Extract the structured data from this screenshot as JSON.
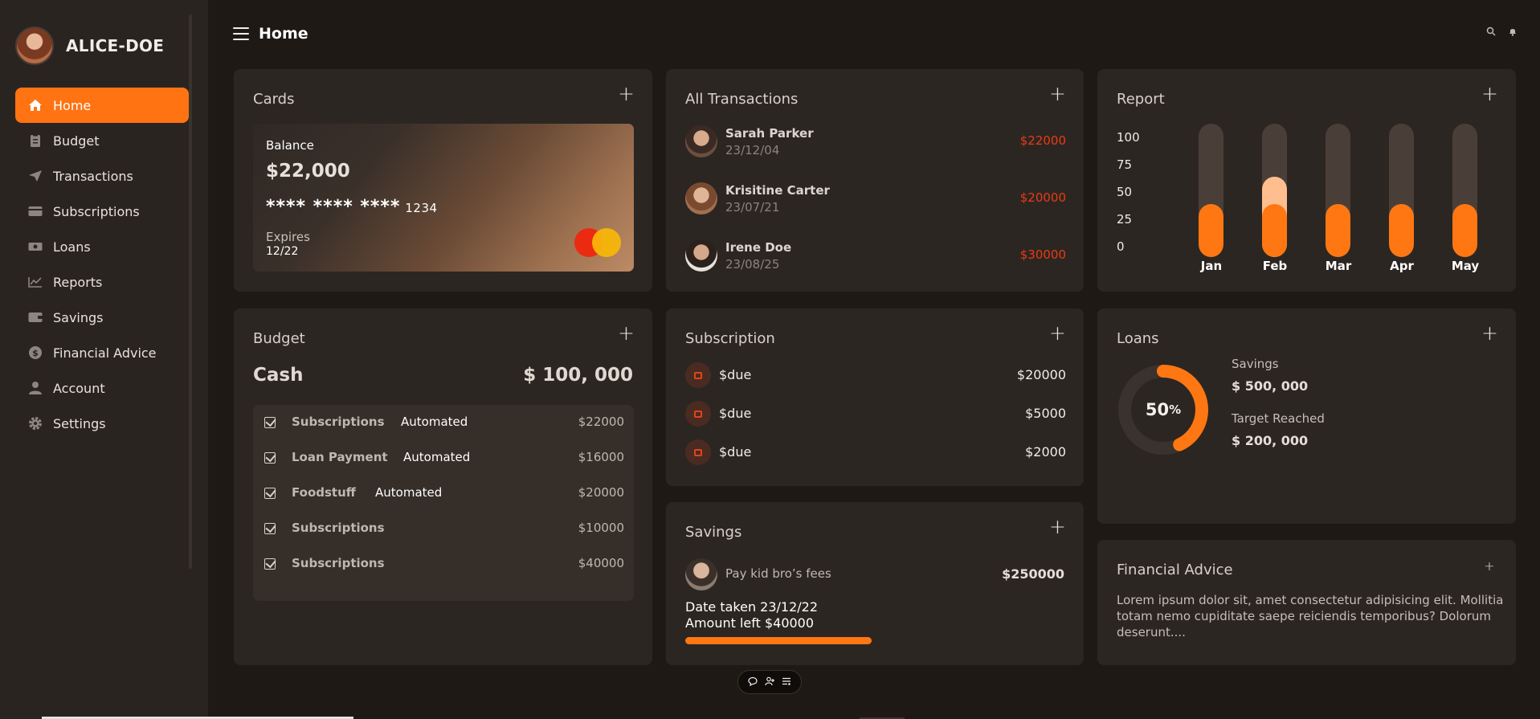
{
  "sidebar": {
    "user_name": "ALICE-DOE",
    "items": [
      {
        "label": "Home",
        "icon": "home-icon"
      },
      {
        "label": "Budget",
        "icon": "clipboard-icon"
      },
      {
        "label": "Transactions",
        "icon": "send-icon"
      },
      {
        "label": "Subscriptions",
        "icon": "wallet-icon"
      },
      {
        "label": "Loans",
        "icon": "cash-icon"
      },
      {
        "label": "Reports",
        "icon": "chart-icon"
      },
      {
        "label": "Savings",
        "icon": "wallet-icon"
      },
      {
        "label": "Financial Advice",
        "icon": "dollar-icon"
      },
      {
        "label": "Account",
        "icon": "user-icon"
      },
      {
        "label": "Settings",
        "icon": "gear-icon"
      }
    ]
  },
  "header": {
    "title": "Home"
  },
  "cards": {
    "title": "Cards",
    "balance_label": "Balance",
    "balance": "$22,000",
    "masked": "**** **** ****",
    "last4": "1234",
    "expires_label": "Expires",
    "expires": "12/22"
  },
  "transactions": {
    "title": "All Transactions",
    "rows": [
      {
        "name": "Sarah Parker",
        "date": "23/12/04",
        "amount": "$22000"
      },
      {
        "name": "Krisitine Carter",
        "date": "23/07/21",
        "amount": "$20000"
      },
      {
        "name": "Irene Doe",
        "date": "23/08/25",
        "amount": "$30000"
      }
    ]
  },
  "report": {
    "title": "Report"
  },
  "chart_data": {
    "type": "bar",
    "categories": [
      "Jan",
      "Feb",
      "Mar",
      "Apr",
      "May"
    ],
    "series": [
      {
        "values": [
          40,
          40,
          40,
          40,
          40
        ]
      },
      {
        "values": [
          0,
          20,
          0,
          0,
          0
        ]
      }
    ],
    "yticks": [
      "100",
      "75",
      "50",
      "25",
      "0"
    ],
    "ylim": [
      0,
      100
    ],
    "colors": [
      "#ff7712",
      "#ffbe8e",
      "#4a3f38"
    ]
  },
  "budget": {
    "title": "Budget",
    "head_label": "Cash",
    "head_value": "$ 100, 000",
    "rows": [
      {
        "name": "Subscriptions",
        "tag": "Automated",
        "value": "$22000"
      },
      {
        "name": "Loan Payment",
        "tag": "Automated",
        "value": "$16000"
      },
      {
        "name": "Foodstuff",
        "tag": "Automated",
        "value": "$20000"
      },
      {
        "name": "Subscriptions",
        "tag": "",
        "value": "$10000"
      },
      {
        "name": "Subscriptions",
        "tag": "",
        "value": "$40000"
      }
    ]
  },
  "subscription": {
    "title": "Subscription",
    "rows": [
      {
        "label": "$due",
        "value": "$20000"
      },
      {
        "label": "$due",
        "value": "$5000"
      },
      {
        "label": "$due",
        "value": "$2000"
      }
    ]
  },
  "savings": {
    "title": "Savings",
    "item": "Pay kid bro’s fees",
    "amount": "$250000",
    "date_taken": "Date taken 23/12/22",
    "amount_left": "Amount left $40000",
    "progress": 0.49
  },
  "loans": {
    "title": "Loans",
    "percent": "50",
    "percent_sign": "%",
    "progress": 0.5,
    "savings_label": "Savings",
    "savings_value": "$ 500, 000",
    "target_label": "Target Reached",
    "target_value": "$ 200, 000"
  },
  "advice": {
    "title": "Financial Advice",
    "text": "Lorem ipsum dolor sit, amet consectetur adipisicing elit. Mollitia totam nemo cupiditate saepe reiciendis temporibus? Dolorum deserunt...."
  },
  "colors": {
    "accent": "#ff7312",
    "background": "#1f1915",
    "card": "#2c2622",
    "negative": "#e83b15"
  }
}
